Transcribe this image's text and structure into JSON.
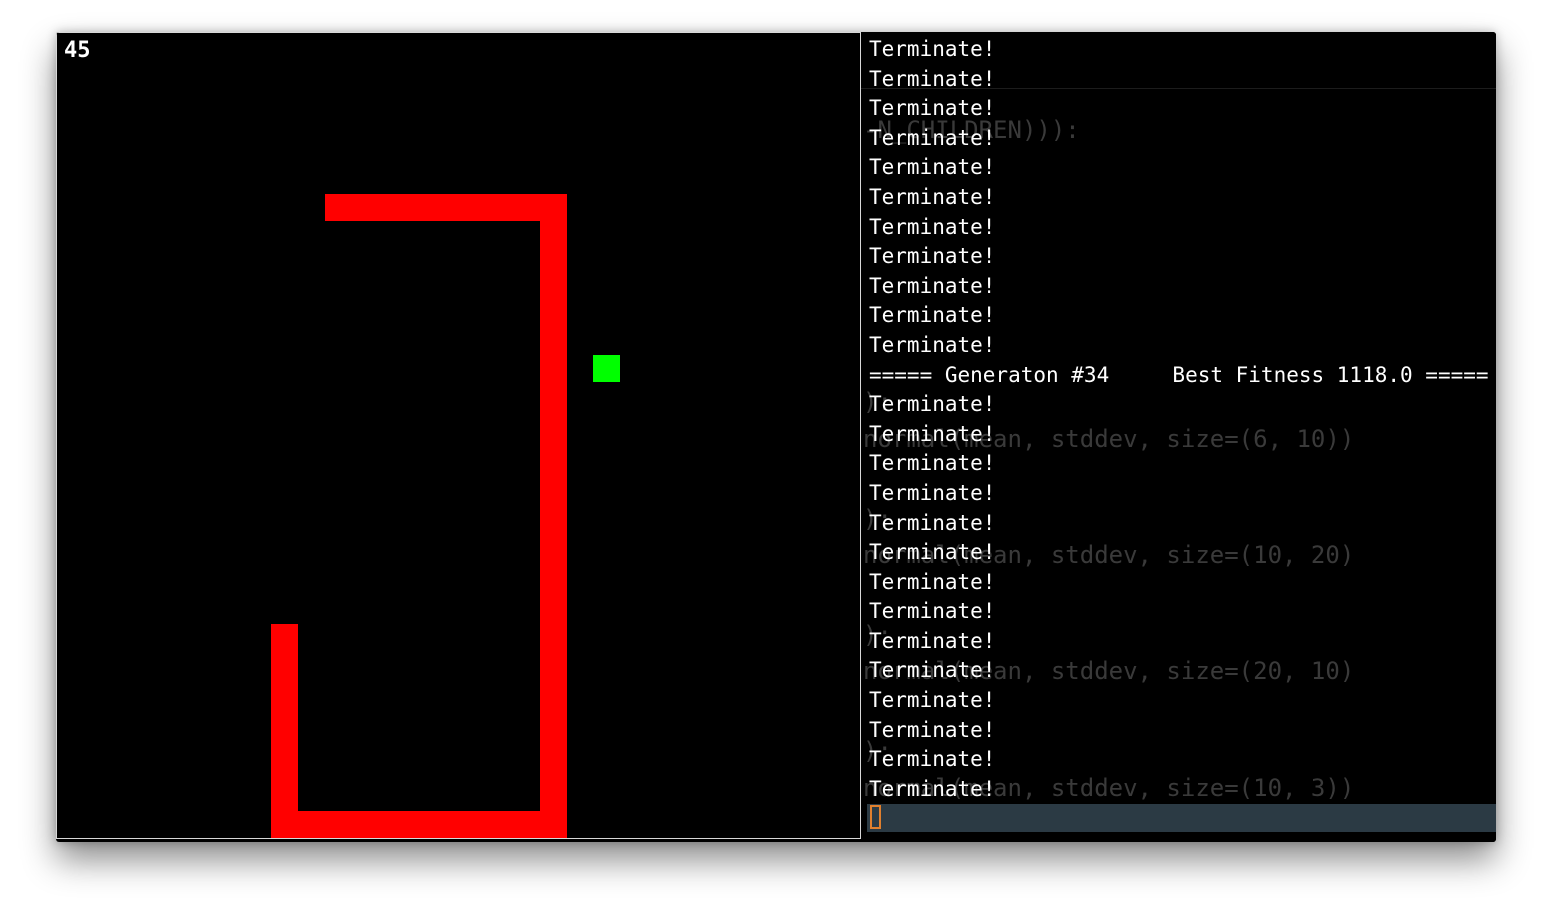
{
  "game": {
    "score": "45",
    "colors": {
      "background": "#000000",
      "snake": "#ff0000",
      "food": "#00ff00"
    },
    "snake_color": "#ff0000",
    "food_color": "#00ff00"
  },
  "terminal": {
    "output_lines": [
      "Terminate!",
      "Terminate!",
      "Terminate!",
      "Terminate!",
      "Terminate!",
      "Terminate!",
      "Terminate!",
      "Terminate!",
      "Terminate!",
      "Terminate!",
      "Terminate!",
      "===== Generaton #34     Best Fitness 1118.0 =====",
      "Terminate!",
      "Terminate!",
      "Terminate!",
      "Terminate!",
      "Terminate!",
      "Terminate!",
      "Terminate!",
      "Terminate!",
      "Terminate!",
      "Terminate!",
      "Terminate!",
      "Terminate!",
      "Terminate!",
      "Terminate!"
    ],
    "background_code": [
      "-N_CHILDREN))):",
      "):",
      "normal(mean, stddev, size=(6, 10))",
      "):",
      "normal(mean, stddev, size=(10, 20)",
      "):",
      "normal(mean, stddev, size=(20, 10)",
      "):",
      "normal(mean, stddev, size=(10, 3))"
    ],
    "cursor_color": "#e07f2e",
    "prompt_bar_color": "#2b3a44"
  }
}
